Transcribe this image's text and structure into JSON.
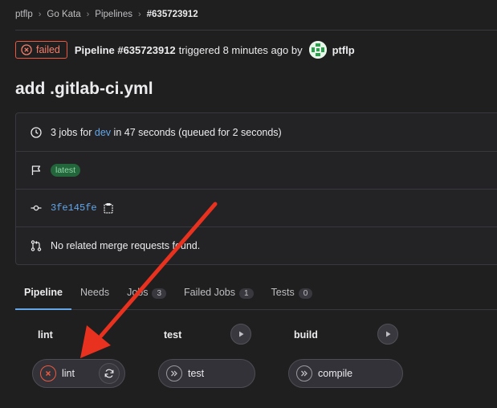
{
  "breadcrumb": [
    "ptflp",
    "Go Kata",
    "Pipelines",
    "#635723912"
  ],
  "pipeline": {
    "status": "failed",
    "id_label": "Pipeline #635723912",
    "triggered_text": "triggered 8 minutes ago by",
    "author": "ptflp"
  },
  "title": "add .gitlab-ci.yml",
  "info": {
    "jobs_prefix": "3 jobs for",
    "branch": "dev",
    "jobs_suffix": "in 47 seconds (queued for 2 seconds)",
    "latest_badge": "latest",
    "commit_sha": "3fe145fe",
    "merge_requests": "No related merge requests found."
  },
  "tabs": [
    {
      "label": "Pipeline",
      "count": ""
    },
    {
      "label": "Needs",
      "count": ""
    },
    {
      "label": "Jobs",
      "count": "3"
    },
    {
      "label": "Failed Jobs",
      "count": "1"
    },
    {
      "label": "Tests",
      "count": "0"
    }
  ],
  "stages": [
    {
      "title": "lint",
      "job": "lint",
      "job_status": "failed"
    },
    {
      "title": "test",
      "job": "test",
      "job_status": "skipped"
    },
    {
      "title": "build",
      "job": "compile",
      "job_status": "skipped"
    }
  ],
  "colors": {
    "background": "#1f1f1f",
    "failed": "#ec5941",
    "link": "#63a6e9",
    "annotation_arrow": "#e8321f"
  },
  "icons": [
    "failed-status-icon",
    "clock-icon",
    "flag-icon",
    "commit-icon",
    "clipboard-icon",
    "merge-request-icon",
    "play-icon",
    "retry-icon",
    "skipped-icon"
  ]
}
